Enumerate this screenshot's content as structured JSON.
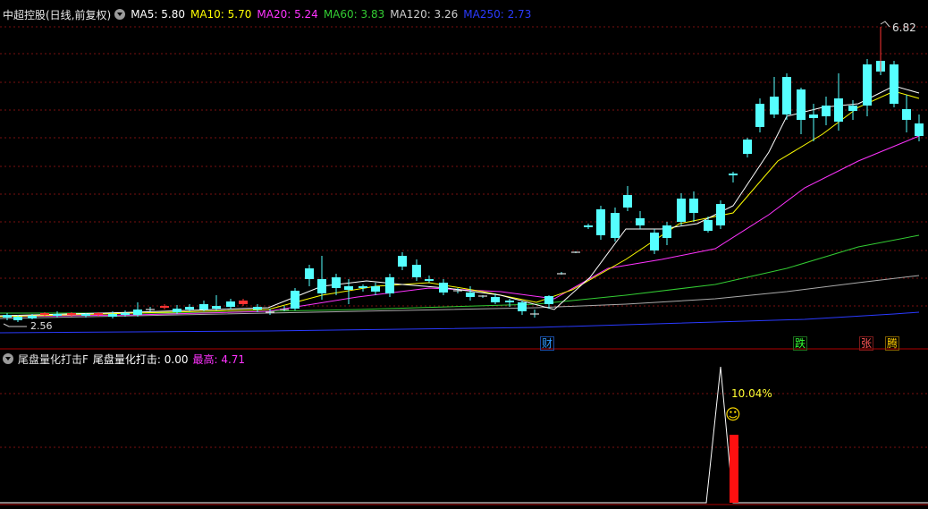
{
  "header": {
    "title": "中超控股(日线,前复权)",
    "ma": [
      {
        "label": "MA5: 5.80",
        "color": "#ffffff"
      },
      {
        "label": "MA10: 5.70",
        "color": "#ffff00"
      },
      {
        "label": "MA20: 5.24",
        "color": "#ff33ff"
      },
      {
        "label": "MA60: 3.83",
        "color": "#33cc33"
      },
      {
        "label": "MA120: 3.26",
        "color": "#cccccc"
      },
      {
        "label": "MA250: 2.73",
        "color": "#2a3aff"
      }
    ]
  },
  "main_chart": {
    "high_label": "6.82",
    "low_label": "2.56",
    "event_markers": [
      {
        "text": "财",
        "color": "#2f9bff"
      },
      {
        "text": "跌",
        "color": "#33ff33"
      },
      {
        "text": "张",
        "color": "#ff5555"
      },
      {
        "text": "腾",
        "color": "#ffcc00"
      }
    ]
  },
  "indicator": {
    "name": "尾盘量化打击F",
    "value_label": "尾盘量化打击: 0.00",
    "max_label": "最高: 4.71",
    "annotation": "10.04%",
    "smile": "☺"
  },
  "colors": {
    "up": "#ff3333",
    "down": "#55ffff",
    "grid": "#7a1010",
    "divider": "#b00000"
  }
}
